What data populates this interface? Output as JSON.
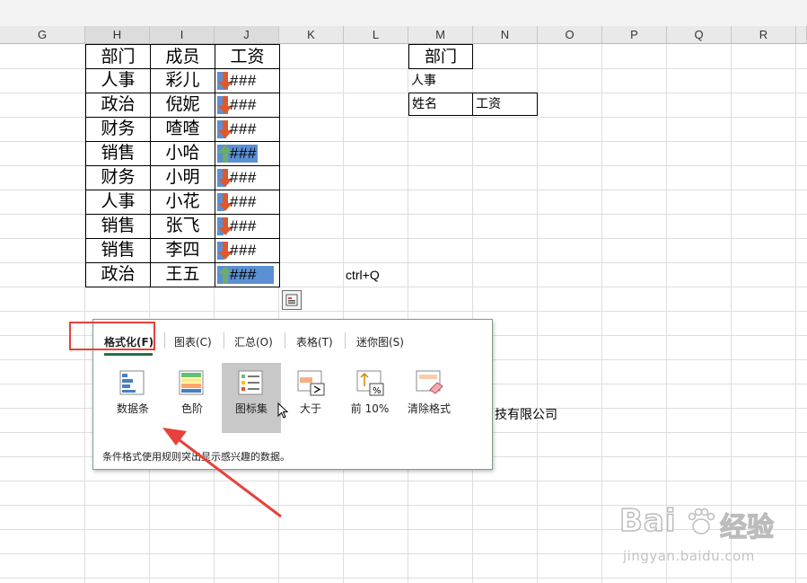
{
  "columns": [
    "G",
    "H",
    "I",
    "J",
    "K",
    "L",
    "M",
    "N",
    "O",
    "P",
    "Q",
    "R"
  ],
  "table": {
    "headers": [
      "部门",
      "成员",
      "工资"
    ],
    "rows": [
      {
        "dept": "人事",
        "member": "彩儿",
        "salary": "###",
        "arrow": "down",
        "bar": 0.18
      },
      {
        "dept": "政治",
        "member": "倪妮",
        "salary": "###",
        "arrow": "down",
        "bar": 0.18
      },
      {
        "dept": "财务",
        "member": "喳喳",
        "salary": "###",
        "arrow": "down",
        "bar": 0.15
      },
      {
        "dept": "销售",
        "member": "小哈",
        "salary": "###",
        "arrow": "up",
        "bar": 0.68
      },
      {
        "dept": "财务",
        "member": "小明",
        "salary": "###",
        "arrow": "down",
        "bar": 0.15
      },
      {
        "dept": "人事",
        "member": "小花",
        "salary": "###",
        "arrow": "down",
        "bar": 0.12
      },
      {
        "dept": "销售",
        "member": "张飞",
        "salary": "###",
        "arrow": "down",
        "bar": 0.1
      },
      {
        "dept": "销售",
        "member": "李四",
        "salary": "###",
        "arrow": "down",
        "bar": 0.12
      },
      {
        "dept": "政治",
        "member": "王五",
        "salary": "###",
        "arrow": "up",
        "bar": 0.95
      }
    ]
  },
  "lookup": {
    "dept_header": "部门",
    "dept_value": "人事",
    "name_label": "姓名",
    "salary_label": "工资"
  },
  "shortcut_text": "ctrl+Q",
  "company_text": "技有限公司",
  "quick_analysis": {
    "tabs": [
      "格式化(F)",
      "图表(C)",
      "汇总(O)",
      "表格(T)",
      "迷你图(S)"
    ],
    "active_tab": "格式化(F)",
    "options": [
      "数据条",
      "色阶",
      "图标集",
      "大于",
      "前 10%",
      "清除格式"
    ],
    "selected_option": "图标集",
    "description": "条件格式使用规则突出显示感兴趣的数据。"
  },
  "watermark": {
    "main": "Bai",
    "brand": "经验",
    "url": "jingyan.baidu.com"
  },
  "colors": {
    "accent": "#217346",
    "highlight": "#e8403a",
    "databar": "#5b8fd3",
    "arrow_down": "#e0582a",
    "arrow_up": "#6dab6b"
  }
}
